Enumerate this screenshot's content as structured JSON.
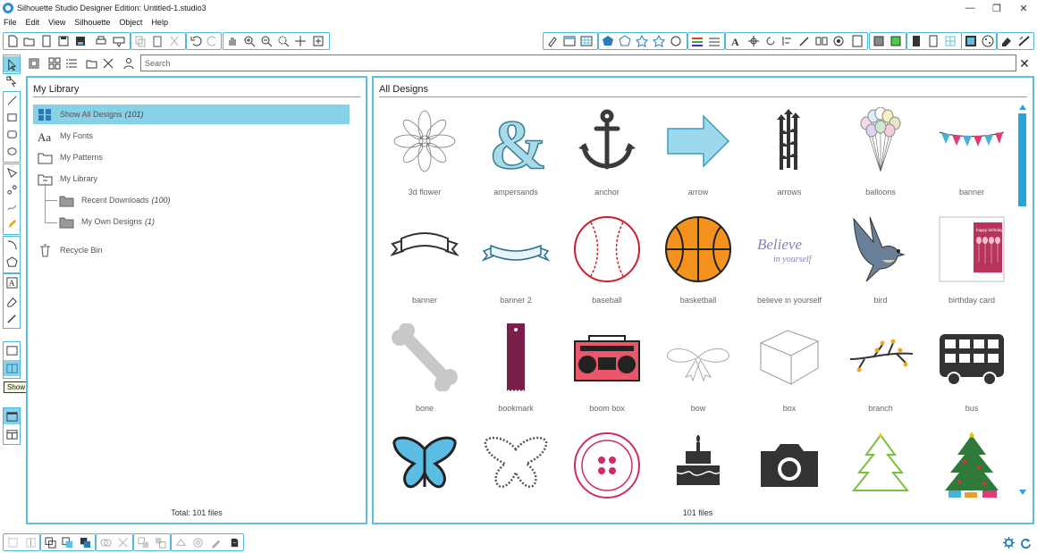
{
  "window": {
    "title": "Silhouette Studio Designer Edition: Untitled-1.studio3",
    "minimize": "—",
    "maximize": "❐",
    "close": "✕"
  },
  "menu": [
    "File",
    "Edit",
    "View",
    "Silhouette",
    "Object",
    "Help"
  ],
  "search": {
    "placeholder": "Search",
    "value": "",
    "clear_label": "✕"
  },
  "tooltip": "Show Library",
  "my_library": {
    "title": "My Library",
    "items": [
      {
        "label": "Show All Designs",
        "count": "(101)",
        "icon": "grid-icon",
        "selected": true
      },
      {
        "label": "My Fonts",
        "count": "",
        "icon": "font-icon"
      },
      {
        "label": "My Patterns",
        "count": "",
        "icon": "folder-icon"
      },
      {
        "label": "My Library",
        "count": "",
        "icon": "folder-minus-icon"
      },
      {
        "label": "Recent Downloads",
        "count": "(100)",
        "icon": "folder-filled-icon"
      },
      {
        "label": "My Own Designs",
        "count": "(1)",
        "icon": "folder-filled-icon"
      },
      {
        "label": "Recycle Bin",
        "count": "",
        "icon": "trash-icon"
      }
    ],
    "total": "Total: 101 files"
  },
  "all_designs": {
    "title": "All Designs",
    "files_count": "101 files",
    "designs": [
      {
        "label": "3d flower",
        "icon": "flower-icon"
      },
      {
        "label": "ampersands",
        "icon": "ampersand-icon"
      },
      {
        "label": "anchor",
        "icon": "anchor-icon"
      },
      {
        "label": "arrow",
        "icon": "arrow-icon"
      },
      {
        "label": "arrows",
        "icon": "arrows-icon"
      },
      {
        "label": "balloons",
        "icon": "balloons-icon"
      },
      {
        "label": "banner",
        "icon": "bunting-icon"
      },
      {
        "label": "banner",
        "icon": "ribbon-banner-icon"
      },
      {
        "label": "banner 2",
        "icon": "ribbon-banner-2-icon"
      },
      {
        "label": "baseball",
        "icon": "baseball-icon"
      },
      {
        "label": "basketball",
        "icon": "basketball-icon"
      },
      {
        "label": "believe in yourself",
        "icon": "believe-text-icon",
        "text_line1": "Believe",
        "text_line2": "in yourself"
      },
      {
        "label": "bird",
        "icon": "bird-icon"
      },
      {
        "label": "birthday card",
        "icon": "birthday-card-icon",
        "card_text": "happy birthday"
      },
      {
        "label": "bone",
        "icon": "bone-icon"
      },
      {
        "label": "bookmark",
        "icon": "bookmark-icon"
      },
      {
        "label": "boom box",
        "icon": "boombox-icon"
      },
      {
        "label": "bow",
        "icon": "bow-icon"
      },
      {
        "label": "box",
        "icon": "box-icon"
      },
      {
        "label": "branch",
        "icon": "branch-icon"
      },
      {
        "label": "bus",
        "icon": "bus-icon"
      },
      {
        "label": "",
        "icon": "butterfly-icon"
      },
      {
        "label": "",
        "icon": "butterfly-outline-icon"
      },
      {
        "label": "",
        "icon": "button-icon"
      },
      {
        "label": "",
        "icon": "cake-icon"
      },
      {
        "label": "",
        "icon": "camera-icon"
      },
      {
        "label": "",
        "icon": "tree-outline-icon"
      },
      {
        "label": "",
        "icon": "christmas-tree-icon"
      }
    ]
  },
  "colors": {
    "accent": "#5cc0e0",
    "selected_bg": "#87d1e9",
    "scroll_thumb": "#29a4d6"
  }
}
